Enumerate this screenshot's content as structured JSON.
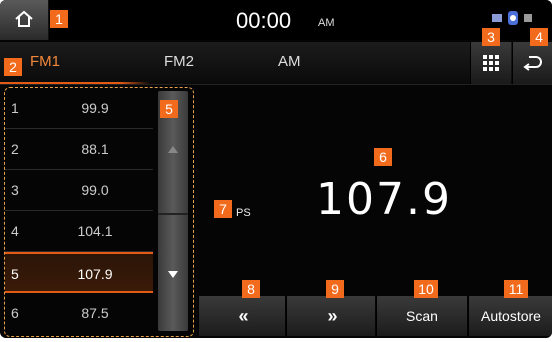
{
  "status": {
    "time": "00:00",
    "ampm": "AM"
  },
  "tabs": [
    {
      "label": "FM1",
      "active": true
    },
    {
      "label": "FM2",
      "active": false
    },
    {
      "label": "AM",
      "active": false
    }
  ],
  "presets": [
    {
      "num": "1",
      "freq": "99.9"
    },
    {
      "num": "2",
      "freq": "88.1"
    },
    {
      "num": "3",
      "freq": "99.0"
    },
    {
      "num": "4",
      "freq": "104.1"
    },
    {
      "num": "5",
      "freq": "107.9",
      "active": true
    },
    {
      "num": "6",
      "freq": "87.5"
    }
  ],
  "display": {
    "ps_label": "PS",
    "frequency": "107.9"
  },
  "controls": {
    "prev": "«",
    "next": "»",
    "scan": "Scan",
    "autostore": "Autostore"
  },
  "callouts": [
    "1",
    "2",
    "3",
    "4",
    "5",
    "6",
    "7",
    "8",
    "9",
    "10",
    "11"
  ],
  "icons": {
    "home": "home-icon",
    "grid": "grid-icon",
    "back": "back-icon",
    "status": "status-icons"
  },
  "colors": {
    "accent": "#e25a14",
    "badge": "#f26b1d",
    "background": "#050505"
  }
}
